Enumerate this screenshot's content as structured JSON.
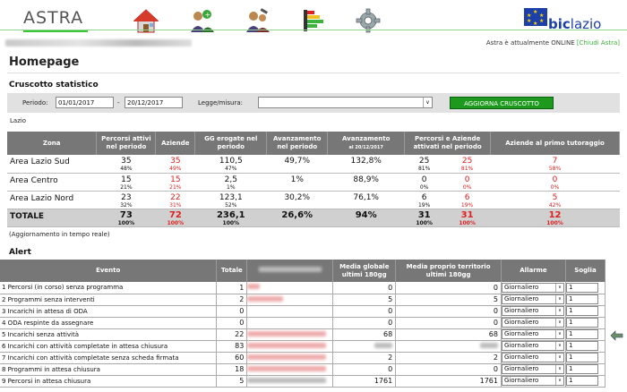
{
  "header": {
    "logo": "ASTRA",
    "brand_bic": "bic",
    "brand_lazio": "lazio",
    "online_text": "Astra è attualmente ONLINE",
    "close_link": "[Chiudi Astra]",
    "nav_icons": [
      "home-icon",
      "companies-add-icon",
      "users-tools-icon",
      "stats-bars-icon",
      "settings-gear-icon"
    ]
  },
  "page_title": "Homepage",
  "cruscotto": {
    "title": "Cruscotto statistico",
    "periodo_label": "Periodo:",
    "date_from": "01/01/2017",
    "date_sep": "-",
    "date_to": "20/12/2017",
    "legge_label": "Legge/misura:",
    "legge_value": "",
    "button": "AGGIORNA CRUSCOTTO",
    "region": "Lazio",
    "headers": [
      "Zona",
      "Percorsi attivi nel periodo",
      "Aziende",
      "GG erogate nel periodo",
      "Avanzamento nel periodo",
      "Avanzamento",
      "al 20/12/2017",
      "Percorsi e Aziende attivati nel periodo",
      "Aziende al primo tutoraggio"
    ],
    "rows": [
      {
        "zona": "Area Lazio Sud",
        "percorsi": "35",
        "percorsi_p": "48%",
        "aziende": "35",
        "aziende_p": "49%",
        "gg": "110,5",
        "gg_p": "47%",
        "avanz": "49,7%",
        "avanz_tot": "132,8%",
        "pa1": "25",
        "pa1_p": "81%",
        "pa2": "25",
        "pa2_p": "81%",
        "tut": "7",
        "tut_p": "58%"
      },
      {
        "zona": "Area Centro",
        "percorsi": "15",
        "percorsi_p": "21%",
        "aziende": "15",
        "aziende_p": "21%",
        "gg": "2,5",
        "gg_p": "1%",
        "avanz": "1%",
        "avanz_tot": "88,9%",
        "pa1": "0",
        "pa1_p": "0%",
        "pa2": "0",
        "pa2_p": "0%",
        "tut": "0",
        "tut_p": "0%"
      },
      {
        "zona": "Area Lazio Nord",
        "percorsi": "23",
        "percorsi_p": "32%",
        "aziende": "22",
        "aziende_p": "31%",
        "gg": "123,1",
        "gg_p": "52%",
        "avanz": "30,2%",
        "avanz_tot": "76,1%",
        "pa1": "6",
        "pa1_p": "19%",
        "pa2": "6",
        "pa2_p": "19%",
        "tut": "5",
        "tut_p": "42%"
      }
    ],
    "total": {
      "zona": "TOTALE",
      "percorsi": "73",
      "percorsi_p": "100%",
      "aziende": "72",
      "aziende_p": "100%",
      "gg": "236,1",
      "gg_p": "100%",
      "avanz": "26,6%",
      "avanz_tot": "94%",
      "pa1": "31",
      "pa1_p": "100%",
      "pa2": "31",
      "pa2_p": "100%",
      "tut": "12",
      "tut_p": "100%"
    },
    "note": "(Aggiornamento in tempo reale)"
  },
  "alert": {
    "title": "Alert",
    "headers": [
      "Evento",
      "Totale",
      "Media globale ultimi 180gg",
      "Media proprio territorio ultimi 180gg",
      "Allarme",
      "Soglia"
    ],
    "rows": [
      {
        "evento": "1 Percorsi (in corso) senza programma",
        "totale": "1",
        "media_g": "0",
        "media_t": "0",
        "allarme": "Giornaliero",
        "soglia": "1"
      },
      {
        "evento": "2 Programmi senza interventi",
        "totale": "2",
        "media_g": "5",
        "media_t": "5",
        "allarme": "Giornaliero",
        "soglia": "1"
      },
      {
        "evento": "3 Incarichi in attesa di ODA",
        "totale": "0",
        "media_g": "0",
        "media_t": "0",
        "allarme": "Giornaliero",
        "soglia": "1"
      },
      {
        "evento": "4 ODA respinte da assegnare",
        "totale": "0",
        "media_g": "0",
        "media_t": "0",
        "allarme": "Giornaliero",
        "soglia": "1"
      },
      {
        "evento": "5 Incarichi senza attività",
        "totale": "22",
        "media_g": "68",
        "media_t": "68",
        "allarme": "Giornaliero",
        "soglia": "1"
      },
      {
        "evento": "6 Incarichi con attività completate in attesa chiusura",
        "totale": "83",
        "media_g": "",
        "media_t": "",
        "allarme": "Giornaliero",
        "soglia": "1"
      },
      {
        "evento": "7 Incarichi con attività completate senza scheda firmata",
        "totale": "60",
        "media_g": "2",
        "media_t": "2",
        "allarme": "Giornaliero",
        "soglia": "1"
      },
      {
        "evento": "8 Programmi in attesa chiusura",
        "totale": "18",
        "media_g": "0",
        "media_t": "0",
        "allarme": "Giornaliero",
        "soglia": "1"
      },
      {
        "evento": "9 Percorsi in attesa chiusura",
        "totale": "5",
        "media_g": "1761",
        "media_t": "1761",
        "allarme": "Giornaliero",
        "soglia": "1"
      }
    ]
  }
}
